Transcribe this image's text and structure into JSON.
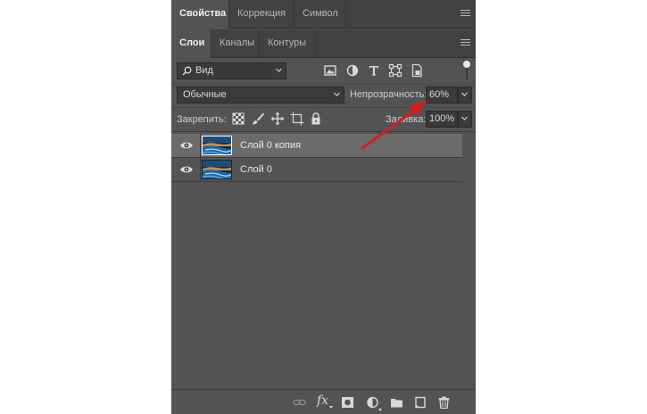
{
  "top_tabs": [
    {
      "label": "Свойства",
      "active": true
    },
    {
      "label": "Коррекция",
      "active": false
    },
    {
      "label": "Символ",
      "active": false
    }
  ],
  "second_tabs": [
    {
      "label": "Слои",
      "active": true
    },
    {
      "label": "Каналы",
      "active": false
    },
    {
      "label": "Контуры",
      "active": false
    }
  ],
  "filter": {
    "kind_label": "Вид",
    "icons": [
      "image-filter-icon",
      "adjustment-filter-icon",
      "type-filter-icon",
      "shape-filter-icon",
      "smart-object-filter-icon"
    ]
  },
  "blend": {
    "mode": "Обычные",
    "opacity_label": "Непрозрачность:",
    "opacity_value": "60%"
  },
  "lock": {
    "label": "Закрепить:",
    "icons": [
      "lock-transparent-pixels-icon",
      "lock-image-pixels-icon",
      "lock-position-icon",
      "lock-artboard-icon",
      "lock-all-icon"
    ],
    "fill_label": "Заливка:",
    "fill_value": "100%"
  },
  "layers": [
    {
      "name": "Слой 0 копия",
      "selected": true,
      "visible": true
    },
    {
      "name": "Слой 0",
      "selected": false,
      "visible": true
    }
  ],
  "bottom_icons": [
    "link-layers-icon",
    "fx-icon",
    "add-mask-icon",
    "new-adjustment-layer-icon",
    "new-group-icon",
    "new-layer-icon",
    "delete-layer-icon"
  ],
  "bottom_fx_label": "fx",
  "colors": {
    "panel_bg": "#535353",
    "tab_bar_bg": "#424242",
    "field_bg": "#3a3a3a",
    "selected_layer_bg": "#6b6b6b",
    "annotation_arrow": "#d21f1f"
  }
}
